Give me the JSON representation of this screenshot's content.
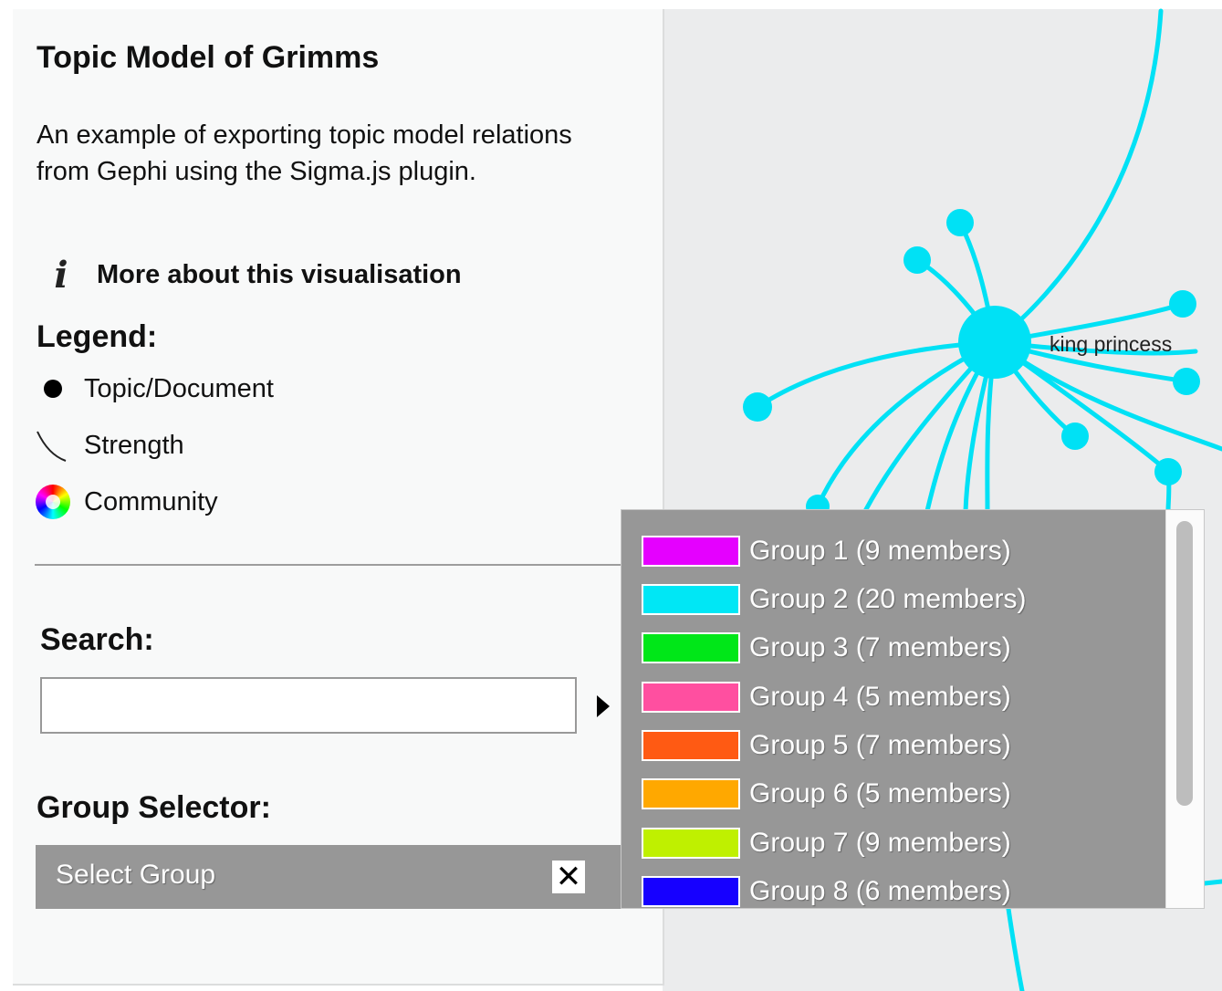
{
  "panel": {
    "title": "Topic Model of Grimms",
    "description": "An example of exporting topic model relations from Gephi using the Sigma.js plugin.",
    "info_link": "More about this visualisation",
    "info_icon": "i",
    "legend_heading": "Legend:",
    "legend": [
      {
        "icon": "dot-icon",
        "label": "Topic/Document"
      },
      {
        "icon": "edge-curve-icon",
        "label": "Strength"
      },
      {
        "icon": "color-wheel-icon",
        "label": "Community"
      }
    ],
    "search_heading": "Search:",
    "search_value": "",
    "group_heading": "Group Selector:",
    "group_select_placeholder": "Select Group",
    "clear_icon": "✕"
  },
  "groups": [
    {
      "label": "Group 1 (9 members)",
      "color": "#e500ff"
    },
    {
      "label": "Group 2 (20 members)",
      "color": "#00e7f5"
    },
    {
      "label": "Group 3 (7 members)",
      "color": "#00e718"
    },
    {
      "label": "Group 4 (5 members)",
      "color": "#ff4fa0"
    },
    {
      "label": "Group 5 (7 members)",
      "color": "#ff5a13"
    },
    {
      "label": "Group 6 (5 members)",
      "color": "#ffa800"
    },
    {
      "label": "Group 7 (9 members)",
      "color": "#bff000"
    },
    {
      "label": "Group 8 (6 members)",
      "color": "#1600ff"
    }
  ],
  "graph": {
    "node_label": "king princess",
    "edge_color": "#00e1f5"
  }
}
